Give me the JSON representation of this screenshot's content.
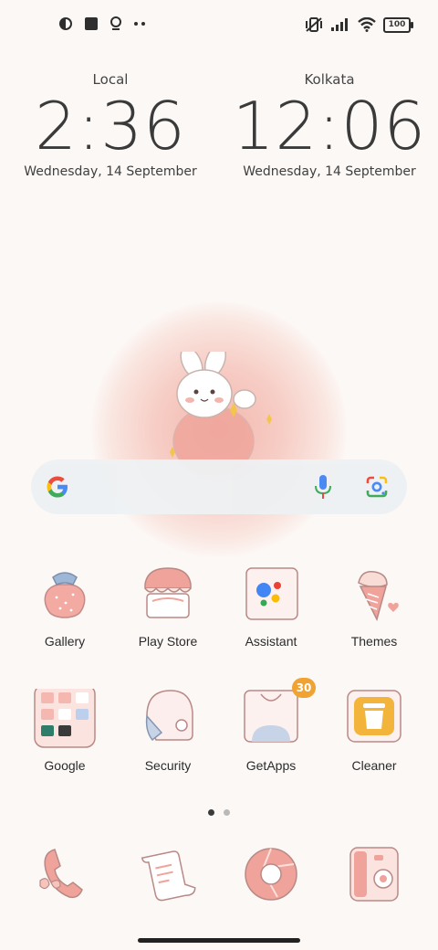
{
  "status_bar": {
    "icons_left": [
      "circle-half-icon",
      "square-icon",
      "lightbulb-icon",
      "more-dots-icon"
    ],
    "icons_right": [
      "vibrate-off-icon",
      "signal-icon",
      "wifi-icon"
    ],
    "battery": "100"
  },
  "clocks": [
    {
      "city": "Local",
      "time": "2:36",
      "date": "Wednesday, 14 September"
    },
    {
      "city": "Kolkata",
      "time": "12:06",
      "date": "Wednesday, 14 September"
    }
  ],
  "search": {
    "logo": "google-g-icon",
    "mic": "mic-icon",
    "lens": "lens-icon"
  },
  "apps_row1": [
    {
      "label": "Gallery"
    },
    {
      "label": "Play Store"
    },
    {
      "label": "Assistant"
    },
    {
      "label": "Themes"
    }
  ],
  "apps_row2": [
    {
      "label": "Google"
    },
    {
      "label": "Security"
    },
    {
      "label": "GetApps",
      "badge": "30"
    },
    {
      "label": "Cleaner"
    }
  ],
  "page_indicator": {
    "pages": 2,
    "current": 1
  },
  "dock": [
    "phone-icon",
    "notes-icon",
    "browser-icon",
    "camera-icon"
  ],
  "colors": {
    "background": "#fcf8f6",
    "accent_pink": "#f0a39a",
    "badge": "#f0a232"
  }
}
